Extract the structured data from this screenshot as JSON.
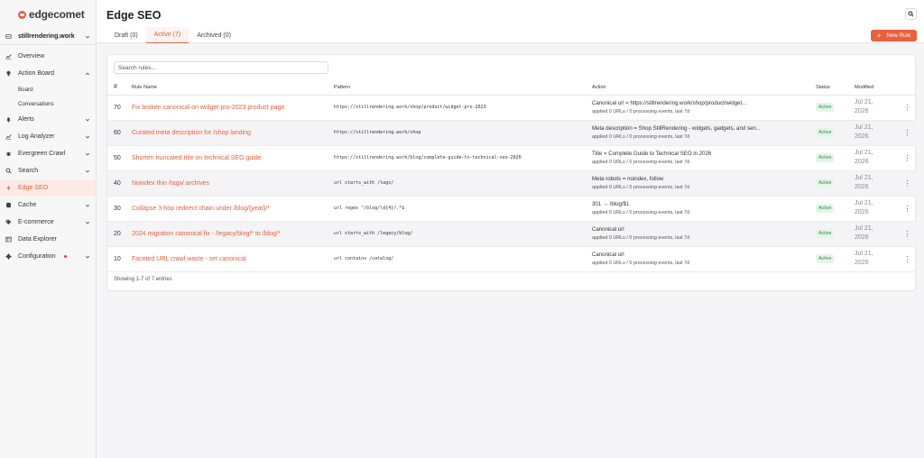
{
  "app": {
    "logo_text": "edgecomet"
  },
  "sidebar": {
    "site": "stillrendering.work",
    "items": [
      {
        "label": "Overview",
        "icon": "chart-icon",
        "chevron": false
      },
      {
        "label": "Action Board",
        "icon": "lightbulb-icon",
        "chevron": true,
        "expanded": true
      },
      {
        "label": "Board",
        "sub": true
      },
      {
        "label": "Conversations",
        "sub": true
      },
      {
        "label": "Alerts",
        "icon": "bell-icon",
        "chevron": true
      },
      {
        "label": "Log Analyzer",
        "icon": "chart-icon",
        "chevron": true
      },
      {
        "label": "Evergreen Crawl",
        "icon": "bug-icon",
        "chevron": true
      },
      {
        "label": "Search",
        "icon": "search-icon",
        "chevron": true
      },
      {
        "label": "Edge SEO",
        "icon": "bolt-icon",
        "chevron": false,
        "active": true
      },
      {
        "label": "Cache",
        "icon": "database-icon",
        "chevron": true
      },
      {
        "label": "E-commerce",
        "icon": "tag-icon",
        "chevron": true
      },
      {
        "label": "Data Explorer",
        "icon": "table-icon",
        "chevron": false
      },
      {
        "label": "Configuration",
        "icon": "gear-icon",
        "chevron": true,
        "dot": true
      }
    ]
  },
  "header": {
    "title": "Edge SEO",
    "tabs": [
      {
        "label": "Draft (0)"
      },
      {
        "label": "Active (7)",
        "active": true
      },
      {
        "label": "Archived (0)"
      }
    ],
    "new_rule_label": "New Rule"
  },
  "rules": {
    "search_placeholder": "Search rules...",
    "columns": [
      "#",
      "Rule Name",
      "Pattern",
      "Action",
      "Status",
      "Modified"
    ],
    "rows": [
      {
        "num": "70",
        "name": "Fix broken canonical on widget-pro-2023 product page",
        "pattern": "https://stillrendering.work/shop/product/widget-pro-2023",
        "action": "Canonical url = https://stillrendering.work/shop/product/widget...",
        "applied": "applied 0 URLs / 0 processing events, last 7d",
        "status": "Active",
        "modified_1": "Jul 21,",
        "modified_2": "2026"
      },
      {
        "num": "60",
        "name": "Curated meta description for /shop landing",
        "pattern": "https://stillrendering.work/shop",
        "action": "Meta description = Shop StillRendering - widgets, gadgets, and sen...",
        "applied": "applied 0 URLs / 0 processing events, last 7d",
        "status": "Active",
        "modified_1": "Jul 21,",
        "modified_2": "2026"
      },
      {
        "num": "50",
        "name": "Shorten truncated title on technical SEO guide",
        "pattern": "https://stillrendering.work/blog/complete-guide-to-technical-seo-2026",
        "action": "Title = Complete Guide to Technical SEO in 2026",
        "applied": "applied 0 URLs / 0 processing events, last 7d",
        "status": "Active",
        "modified_1": "Jul 21,",
        "modified_2": "2026"
      },
      {
        "num": "40",
        "name": "Noindex thin /tags/ archives",
        "pattern": "url starts_with /tags/",
        "action": "Meta robots = noindex, follow",
        "applied": "applied 0 URLs / 0 processing events, last 7d",
        "status": "Active",
        "modified_1": "Jul 21,",
        "modified_2": "2026"
      },
      {
        "num": "30",
        "name": "Collapse 3-hop redirect chain under /blog/{year}/*",
        "pattern": "url regex ^/blog/\\d{4}/.*$",
        "action": "301 → /blog/$1",
        "applied": "applied 0 URLs / 0 processing events, last 7d",
        "status": "Active",
        "modified_1": "Jul 21,",
        "modified_2": "2026"
      },
      {
        "num": "20",
        "name": "2024 migration canonical fix - /legacy/blog/* to /blog/*",
        "pattern": "url starts_with /legacy/blog/",
        "action": "Canonical url",
        "applied": "applied 0 URLs / 0 processing events, last 7d",
        "status": "Active",
        "modified_1": "Jul 21,",
        "modified_2": "2026"
      },
      {
        "num": "10",
        "name": "Faceted URL crawl waste - set canonical",
        "pattern": "url contains /catalog/",
        "action": "Canonical url",
        "applied": "applied 0 URLs / 0 processing events, last 7d",
        "status": "Active",
        "modified_1": "Jul 21,",
        "modified_2": "2026"
      }
    ],
    "footer": "Showing 1-7 of 7 entries"
  },
  "colors": {
    "accent": "#e8603c",
    "status_active_bg": "#e4f5e9",
    "status_active_text": "#2e8b4f"
  }
}
